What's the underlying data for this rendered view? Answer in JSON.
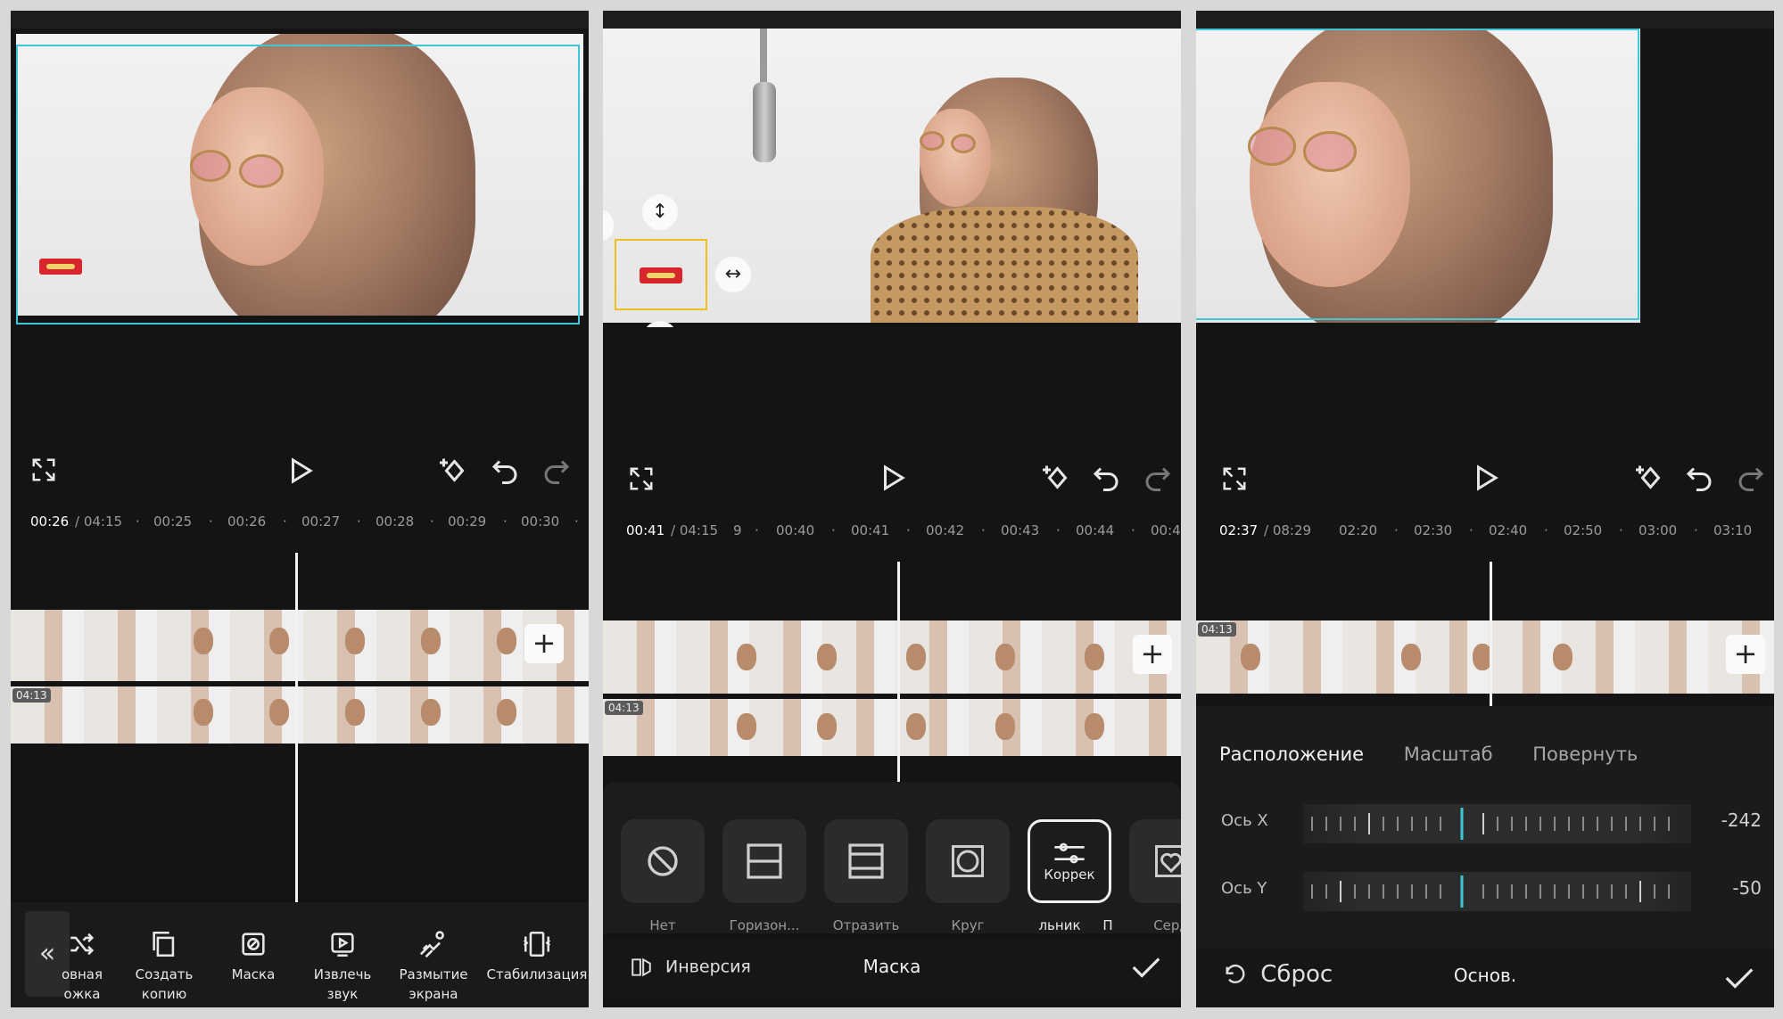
{
  "colors": {
    "accent": "#3fc7d9",
    "selection": "#f0c020",
    "background": "#141414"
  },
  "panel1": {
    "time_current": "00:26",
    "time_total": "/ 04:15",
    "ticks": [
      "00:25",
      "00:26",
      "00:27",
      "00:28",
      "00:29",
      "00:30"
    ],
    "clip_badge": "04:13",
    "tools": [
      {
        "label": "овная\nожка",
        "icon": "shuffle-icon"
      },
      {
        "label": "Создать\nкопию",
        "icon": "copy-icon"
      },
      {
        "label": "Маска",
        "icon": "mask-icon"
      },
      {
        "label": "Извлечь\nзвук",
        "icon": "extract-audio-icon"
      },
      {
        "label": "Размытие\nэкрана",
        "icon": "blur-icon"
      },
      {
        "label": "Стабилизация",
        "icon": "stabilize-icon"
      }
    ],
    "back_glyph": "«"
  },
  "panel2": {
    "time_current": "00:41",
    "time_total": "/ 04:15",
    "tick_partial": "9",
    "ticks": [
      "00:40",
      "00:41",
      "00:42",
      "00:43",
      "00:44",
      "00:4"
    ],
    "clip_badge": "04:13",
    "shapes": [
      {
        "label": "Нет",
        "icon": "none-icon"
      },
      {
        "label": "Горизон...",
        "icon": "horizontal-icon"
      },
      {
        "label": "Отразить",
        "icon": "mirror-icon"
      },
      {
        "label": "Круг",
        "icon": "circle-icon"
      },
      {
        "label": "льник",
        "icon": "rectangle-icon",
        "overlay": "Коррек"
      },
      {
        "label": "Серд",
        "icon": "heart-icon"
      }
    ],
    "extra_label": "П",
    "invert_label": "Инверсия",
    "title": "Маска"
  },
  "panel3": {
    "time_current": "02:37",
    "time_total": "/ 08:29",
    "ticks": [
      "02:20",
      "02:30",
      "02:40",
      "02:50",
      "03:00",
      "03:10"
    ],
    "clip_badge": "04:13",
    "tabs": [
      "Расположение",
      "Масштаб",
      "Повернуть"
    ],
    "axis_x": {
      "label": "Ось X",
      "value": "-242"
    },
    "axis_y": {
      "label": "Ось Y",
      "value": "-50"
    },
    "reset_label": "Сброс",
    "title": "Основ."
  }
}
